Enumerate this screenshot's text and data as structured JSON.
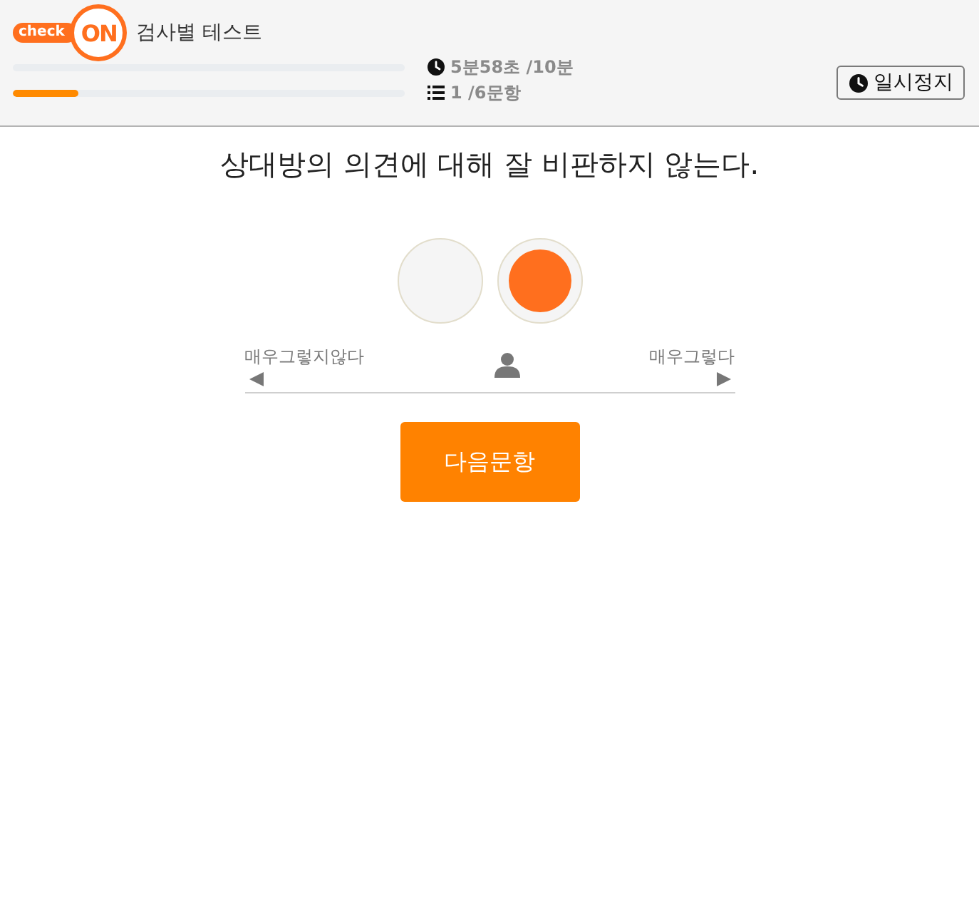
{
  "header": {
    "logo": {
      "badge": "check",
      "emblem": "ON"
    },
    "title": "검사별 테스트",
    "question_progress": {
      "level": 0.167
    },
    "stats": [
      {
        "kind": "time",
        "text": "5분58초 /10분"
      },
      {
        "kind": "questions",
        "text": "1 /6문항"
      }
    ],
    "pause_button": {
      "label": "일시정지"
    }
  },
  "question": {
    "text": "상대방의 의견에 대해 잘 비판하지 않는다.",
    "choices": [
      {
        "selected": false
      },
      {
        "selected": true
      }
    ],
    "scale": {
      "left_label": "매우그렇지않다",
      "right_label": "매우그렇다"
    }
  },
  "next_button": {
    "label": "다음문항"
  }
}
